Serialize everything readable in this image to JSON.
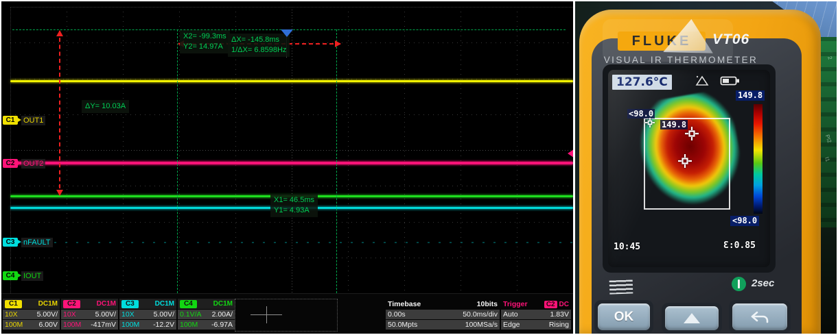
{
  "scope": {
    "cursors": {
      "x2": "X2= -99.3ms",
      "y2": "Y2= 14.97A",
      "dx": "ΔX= -145.8ms",
      "inv_dx": "1/ΔX= 6.8598Hz",
      "dy": "ΔY= 10.03A",
      "x1": "X1= 46.5ms",
      "y1": "Y1= 4.93A"
    },
    "channels": [
      {
        "id": "C1",
        "label": "OUT1",
        "coupling": "DC1M",
        "probe": "10X",
        "scale": "5.00V/",
        "bandwidth": "100M",
        "offset": "6.00V",
        "color": "#f0e000"
      },
      {
        "id": "C2",
        "label": "OUT2",
        "coupling": "DC1M",
        "probe": "10X",
        "scale": "5.00V/",
        "bandwidth": "100M",
        "offset": "-417mV",
        "color": "#ff1378"
      },
      {
        "id": "C3",
        "label": "nFAULT",
        "coupling": "DC1M",
        "probe": "10X",
        "scale": "5.00V/",
        "bandwidth": "100M",
        "offset": "-12.2V",
        "color": "#00dede"
      },
      {
        "id": "C4",
        "label": "IOUT",
        "coupling": "DC1M",
        "probe": "0.1V/A",
        "scale": "2.00A/",
        "bandwidth": "100M",
        "offset": "-6.97A",
        "color": "#12d812"
      }
    ],
    "timebase": {
      "title": "Timebase",
      "adc_bits": "10bits",
      "delay": "0.00s",
      "scale": "50.0ms/div",
      "memory": "50.0Mpts",
      "sample_rate": "100MSa/s"
    },
    "trigger": {
      "title": "Trigger",
      "source": "C2",
      "coupling": "DC",
      "mode": "Auto",
      "level": "1.83V",
      "type": "Edge",
      "slope": "Rising"
    }
  },
  "thermometer": {
    "brand": "FLUKE",
    "model": "VT06",
    "subtitle": "VISUAL IR THERMOMETER",
    "display": {
      "center_temp": "127.6°C",
      "scale_max": "149.8",
      "scale_min": "<98.0",
      "hot_marker": "149.8",
      "cold_marker": "<98.0",
      "time": "10:45",
      "emissivity": "Ɛ:0.85"
    },
    "controls": {
      "ok": "OK",
      "power_hold_hint": "2sec"
    },
    "accent_color": "#f2a71b"
  },
  "background": {
    "pcb_marks": [
      "2",
      "PI2",
      "I1"
    ]
  }
}
